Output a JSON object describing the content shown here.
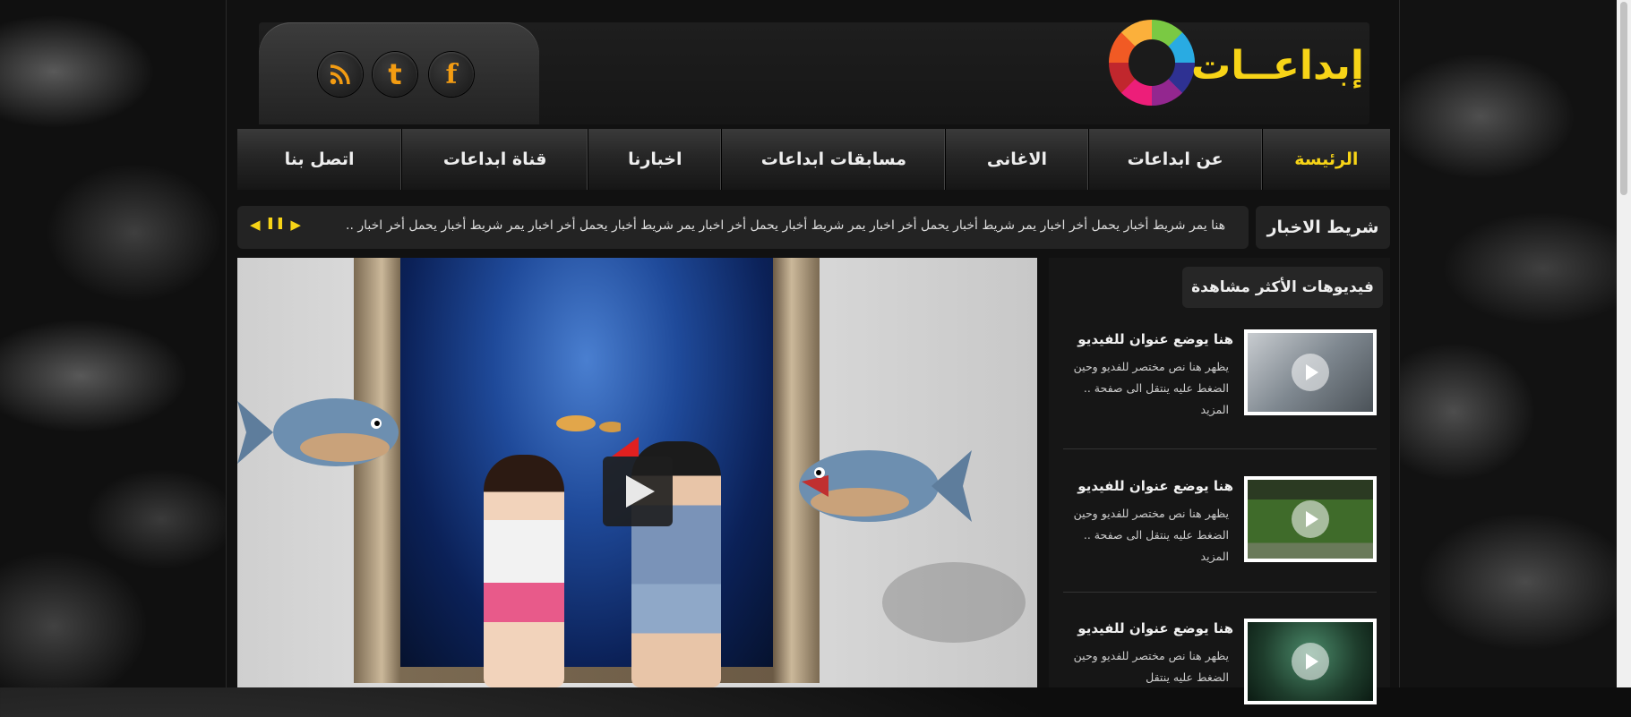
{
  "header": {
    "logo_text": "إبداعــات",
    "social": [
      {
        "name": "facebook",
        "glyph": "f"
      },
      {
        "name": "twitter",
        "glyph": "t"
      },
      {
        "name": "rss",
        "glyph": "rss"
      }
    ]
  },
  "nav": {
    "items": [
      "الرئيسة",
      "عن ابداعات",
      "الاغانى",
      "مسابقات ابداعات",
      "اخبارنا",
      "قناة ابداعات",
      "اتصل بنا"
    ],
    "active_index": 0
  },
  "ticker": {
    "label": "شريط الاخبار",
    "text": "هنا يمر شريط أخبار يحمل أخر اخبار يمر شريط أخبار يحمل أخر اخبار يمر شريط أخبار يحمل أخر اخبار  يمر شريط أخبار يحمل أخر اخبار  يمر شريط أخبار يحمل أخر اخبار  ..",
    "controls": {
      "prev": "◀",
      "pause": "❚❚",
      "next": "▶"
    }
  },
  "sidebar": {
    "title": "فيديوهات الأكثر مشاهدة",
    "videos": [
      {
        "title": "هنا يوضع عنوان للفيديو",
        "desc": "يظهر هنا نص مختصر للفديو وحين الضغط عليه ينتقل الى صفحة .. المزيد"
      },
      {
        "title": "هنا يوضع عنوان للفيديو",
        "desc": "يظهر هنا نص مختصر للفديو وحين الضغط عليه ينتقل الى صفحة .. المزيد"
      },
      {
        "title": "هنا يوضع عنوان للفيديو",
        "desc": "يظهر هنا نص مختصر للفديو وحين الضغط عليه ينتقل"
      }
    ]
  },
  "colors": {
    "accent": "#f7d417",
    "social": "#f39c12",
    "background": "#111111"
  }
}
